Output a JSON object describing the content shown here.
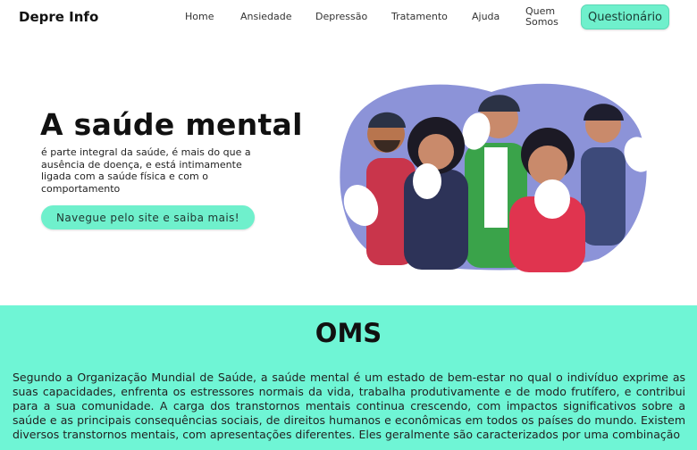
{
  "nav": {
    "brand": "Depre Info",
    "links": [
      "Home",
      "Ansiedade",
      "Depressão",
      "Tratamento",
      "Ajuda",
      "Quem Somos"
    ],
    "cta": "Questionário"
  },
  "hero": {
    "title": "A saúde mental",
    "text": "é parte integral da saúde, é mais do que a ausência de doença, e está intimamente ligada com a saúde física e com o comportamento",
    "button": "Navegue pelo site e saiba mais!"
  },
  "oms": {
    "title": "OMS",
    "text": "Segundo a Organização Mundial de Saúde, a saúde mental é um estado de bem-estar no qual o indivíduo exprime as suas capacidades, enfrenta os estressores normais da vida, trabalha produtivamente e de modo frutífero, e contribui para a sua comunidade. A carga dos transtornos mentais continua crescendo, com impactos significativos sobre a saúde e as principais consequências sociais, de direitos humanos e econômicas em todos os países do mundo. Existem diversos transtornos mentais, com apresentações diferentes. Eles geralmente são caracterizados por uma combinação"
  },
  "colors": {
    "accent": "#6ff0cc",
    "section_bg": "#6ff5d5",
    "illustration_blob": "#8c93d8"
  }
}
